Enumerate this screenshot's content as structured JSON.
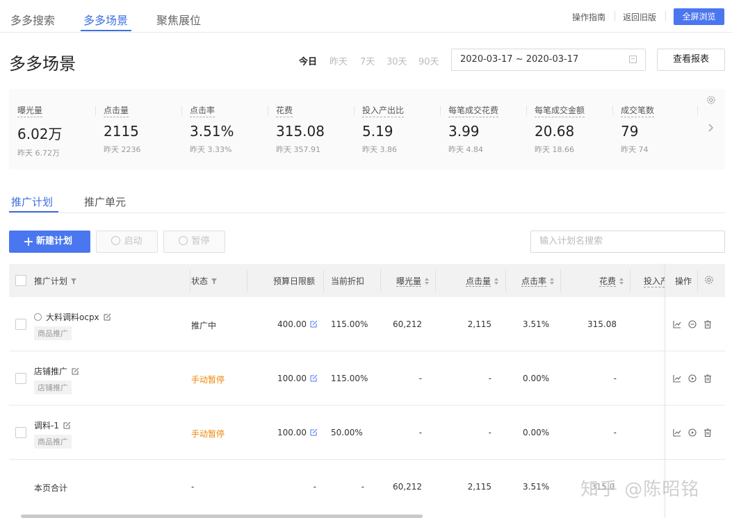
{
  "topnav": {
    "tabs": [
      "多多搜索",
      "多多场景",
      "聚焦展位"
    ],
    "active_tab": "多多场景",
    "links": [
      "操作指南",
      "返回旧版"
    ],
    "fullscreen_label": "全屏浏览"
  },
  "header": {
    "title": "多多场景",
    "ranges": [
      "今日",
      "昨天",
      "7天",
      "30天",
      "90天"
    ],
    "active_range": "今日",
    "date_range": "2020-03-17 ~ 2020-03-17",
    "report_label": "查看报表"
  },
  "metrics": [
    {
      "label": "曝光量",
      "value": "6.02万",
      "prev": "昨天 6.72万"
    },
    {
      "label": "点击量",
      "value": "2115",
      "prev": "昨天 2236"
    },
    {
      "label": "点击率",
      "value": "3.51%",
      "prev": "昨天 3.33%"
    },
    {
      "label": "花费",
      "value": "315.08",
      "prev": "昨天 357.91"
    },
    {
      "label": "投入产出比",
      "value": "5.19",
      "prev": "昨天 3.86"
    },
    {
      "label": "每笔成交花费",
      "value": "3.99",
      "prev": "昨天 4.84"
    },
    {
      "label": "每笔成交金额",
      "value": "20.68",
      "prev": "昨天 18.66"
    },
    {
      "label": "成交笔数",
      "value": "79",
      "prev": "昨天 74"
    }
  ],
  "subtabs": [
    "推广计划",
    "推广单元"
  ],
  "toolbar": {
    "new_label": "新建计划",
    "start_label": "启动",
    "pause_label": "暂停",
    "search_placeholder": "输入计划名搜索"
  },
  "table": {
    "headers": {
      "plan": "推广计划",
      "status": "状态",
      "budget": "预算日限额",
      "discount": "当前折扣",
      "impressions": "曝光量",
      "clicks": "点击量",
      "ctr": "点击率",
      "cost": "花费",
      "roi": "投入产",
      "ops": "操作"
    },
    "rows": [
      {
        "name": "大料调料ocpx",
        "tag": "商品推广",
        "status": "推广中",
        "budget": "400.00",
        "discount": "115.00%",
        "impressions": "60,212",
        "clicks": "2,115",
        "ctr": "3.51%",
        "cost": "315.08"
      },
      {
        "name": "店铺推广",
        "tag": "店铺推广",
        "status": "手动暂停",
        "budget": "100.00",
        "discount": "115.00%",
        "impressions": "-",
        "clicks": "-",
        "ctr": "0.00%",
        "cost": "-"
      },
      {
        "name": "调料-1",
        "tag": "商品推广",
        "status": "手动暂停",
        "budget": "100.00",
        "discount": "50.00%",
        "impressions": "-",
        "clicks": "-",
        "ctr": "0.00%",
        "cost": "-"
      }
    ],
    "summary": {
      "label": "本页合计",
      "status": "-",
      "budget": "-",
      "discount": "-",
      "impressions": "60,212",
      "clicks": "2,115",
      "ctr": "3.51%",
      "cost": "315.0"
    }
  },
  "watermark": "知乎 @陈昭铭",
  "colors": {
    "accent": "#4a76f0",
    "paused": "#f0860a"
  }
}
